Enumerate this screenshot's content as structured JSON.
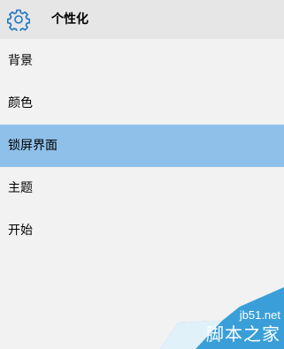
{
  "header": {
    "icon": "gear-icon",
    "title": "个性化"
  },
  "menu": {
    "items": [
      {
        "label": "背景"
      },
      {
        "label": "颜色"
      },
      {
        "label": "锁屏界面",
        "selected": true
      },
      {
        "label": "主题"
      },
      {
        "label": "开始"
      }
    ]
  },
  "watermark": {
    "domain": "jb51.net",
    "name": "脚本之家"
  },
  "colors": {
    "header_bg": "#e6e6e6",
    "page_bg": "#f2f2f2",
    "selected_bg": "#8fc0e9",
    "accent": "#1e74c6",
    "watermark_blue": "#3a9fd8"
  }
}
